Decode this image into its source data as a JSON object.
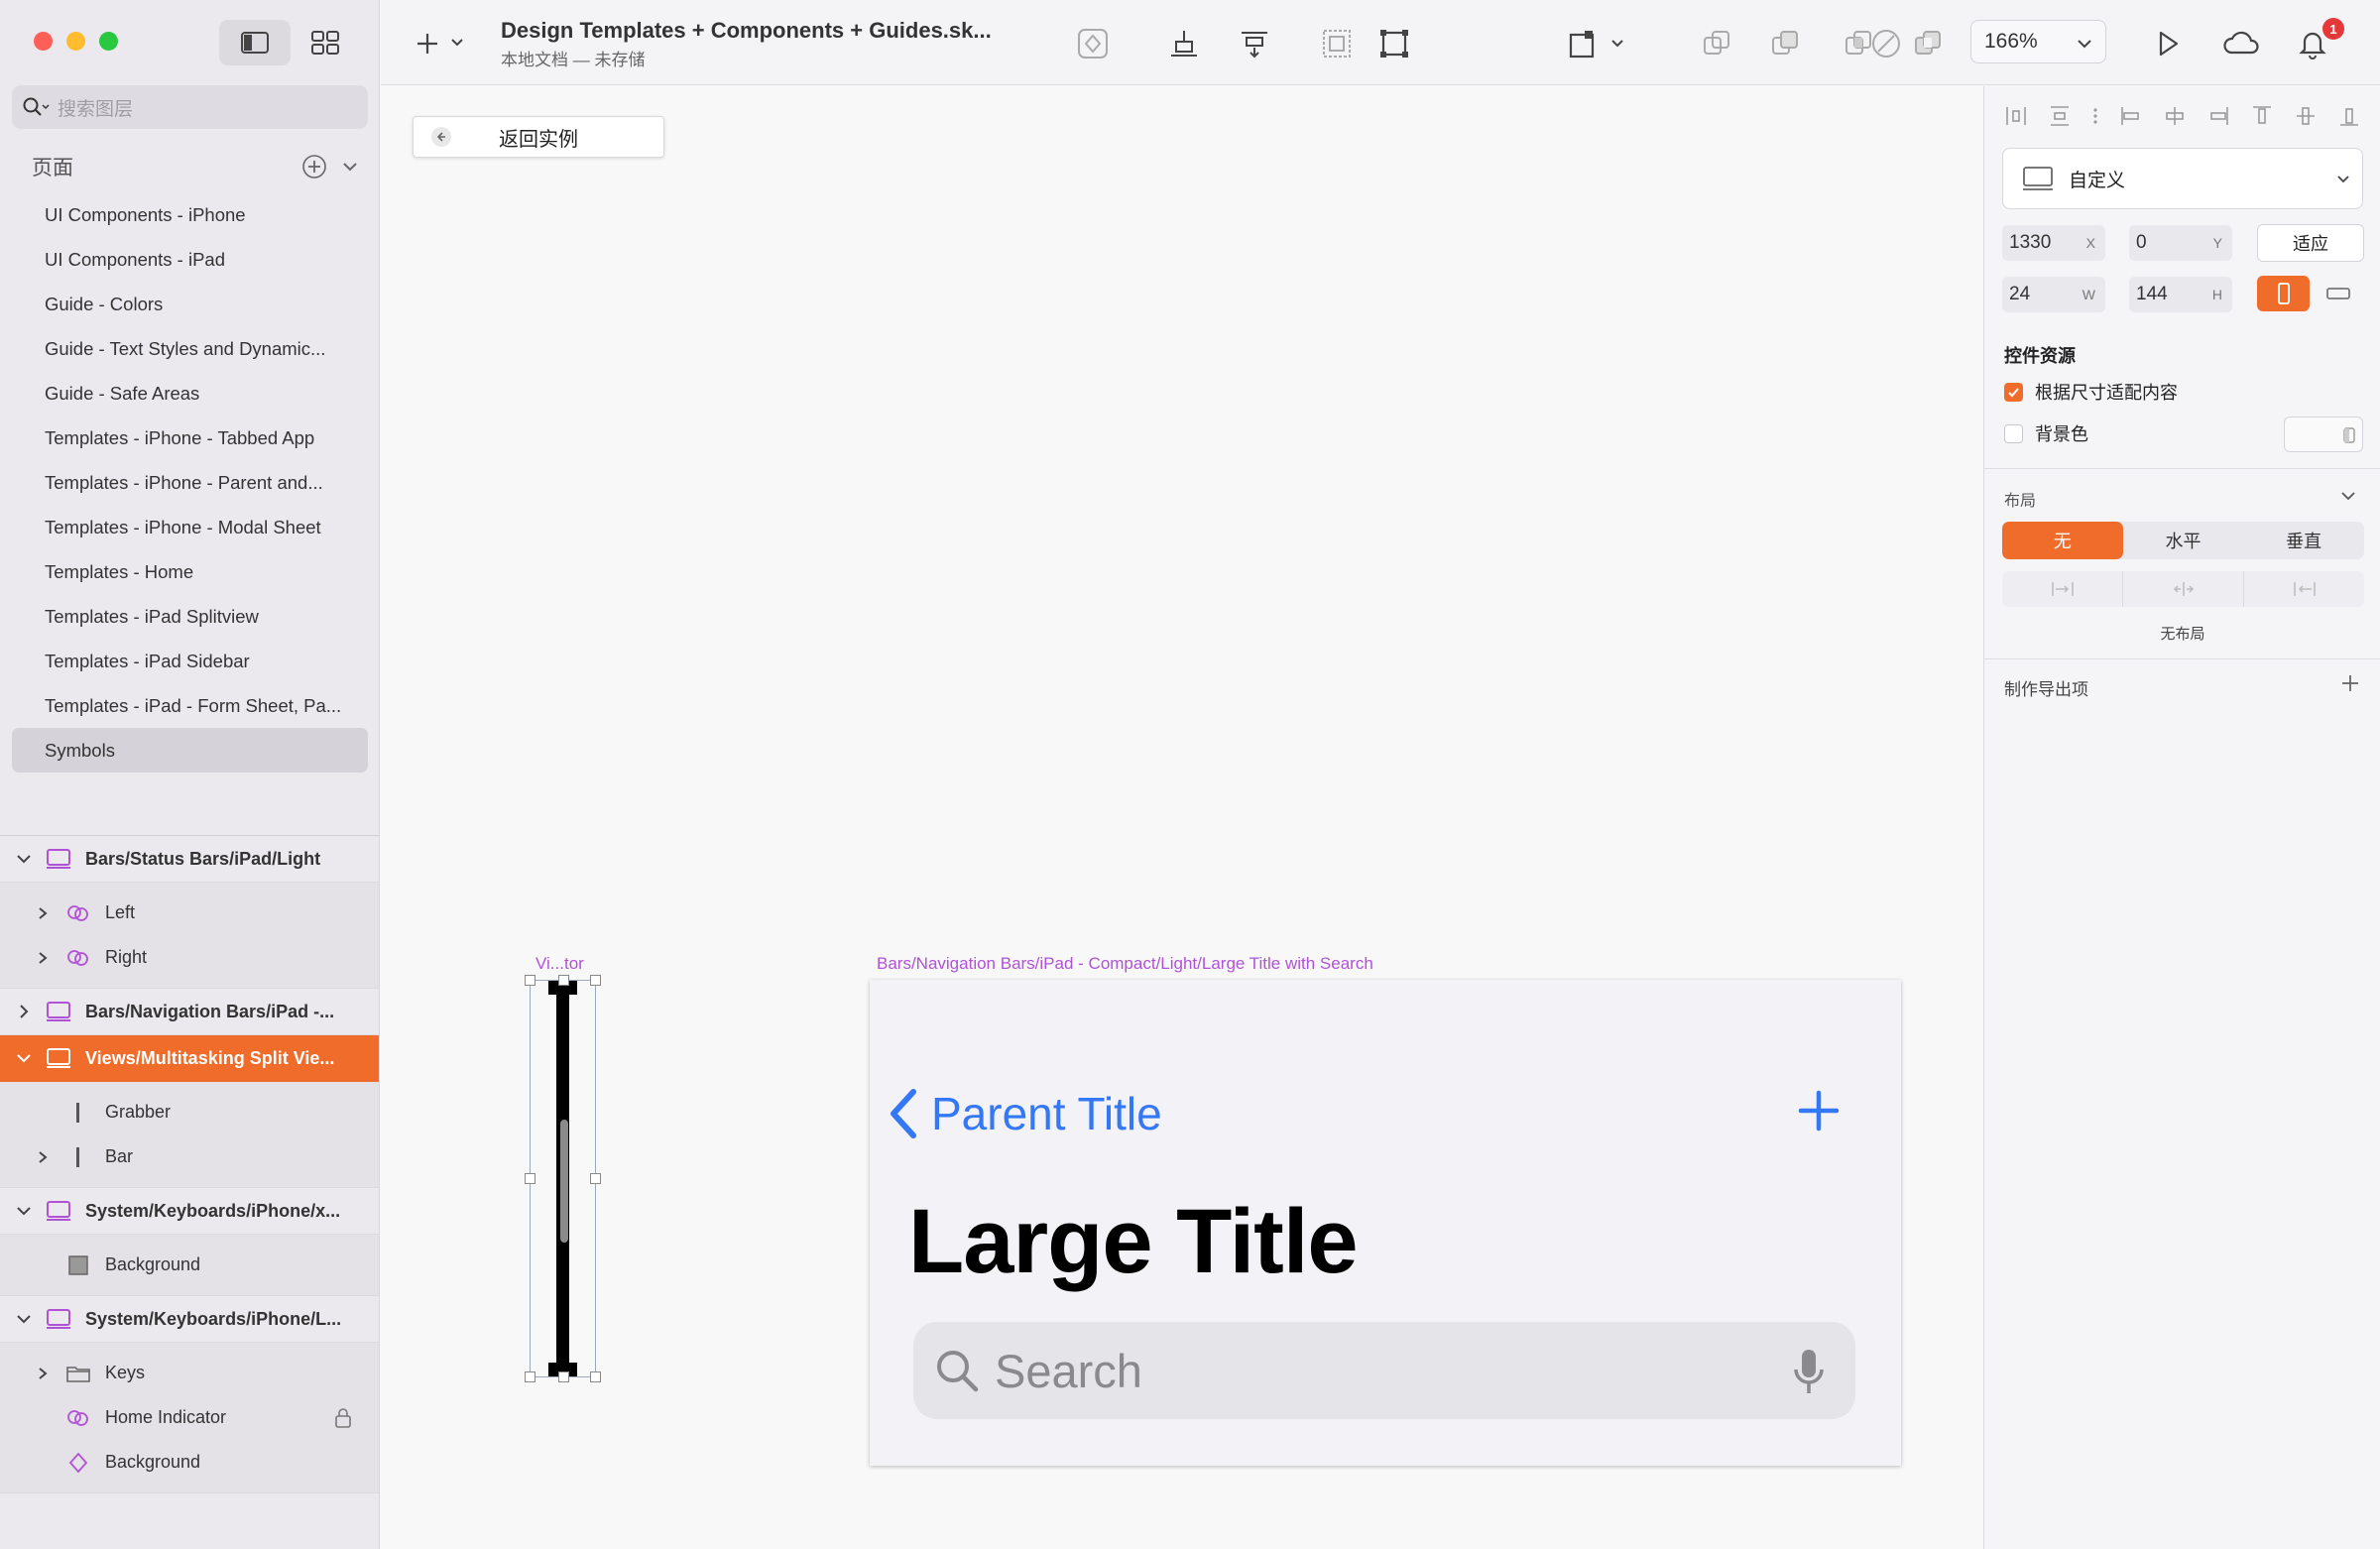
{
  "window": {
    "traffic_lights": [
      "close",
      "minimize",
      "zoom"
    ]
  },
  "sidebar": {
    "search_placeholder": "搜索图层",
    "pages_title": "页面",
    "pages": [
      "UI Components - iPhone",
      "UI Components - iPad",
      "Guide - Colors",
      "Guide - Text Styles and Dynamic...",
      "Guide - Safe Areas",
      "Templates - iPhone - Tabbed App",
      "Templates - iPhone - Parent and...",
      "Templates - iPhone - Modal Sheet",
      "Templates - Home",
      "Templates - iPad Splitview",
      "Templates - iPad Sidebar",
      "Templates - iPad - Form Sheet, Pa...",
      "Symbols"
    ],
    "selected_page": "Symbols",
    "layers": {
      "g1": {
        "name": "Bars/Status Bars/iPad/Light",
        "children": [
          "Left",
          "Right"
        ]
      },
      "g2": {
        "name": "Bars/Navigation Bars/iPad -..."
      },
      "g3": {
        "name": "Views/Multitasking Split Vie...",
        "children": [
          "Grabber",
          "Bar"
        ]
      },
      "g4": {
        "name": "System/Keyboards/iPhone/x...",
        "children": [
          "Background"
        ]
      },
      "g5": {
        "name": "System/Keyboards/iPhone/L...",
        "children": [
          "Keys",
          "Home Indicator",
          "Background"
        ]
      }
    },
    "selected_layer": "Views/Multitasking Split Vie..."
  },
  "toolbar": {
    "doc_title": "Design Templates + Components + Guides.sk...",
    "doc_subtitle": "本地文档 — 未存储",
    "zoom": "166%",
    "notification_count": "1",
    "icons": [
      "insert-icon",
      "create-symbol-icon",
      "align-bottom-icon",
      "distribute-icon",
      "mask-icon",
      "scale-icon",
      "edit-path-icon",
      "transform-icon",
      "union-icon",
      "subtract-icon",
      "intersect-icon",
      "difference-icon",
      "play-icon",
      "cloud-icon",
      "bell-icon"
    ]
  },
  "canvas": {
    "back_button": "返回实例",
    "artboard1_label": "Vi...tor",
    "artboard2_label": "Bars/Navigation Bars/iPad - Compact/Light/Large Title with Search",
    "nav": {
      "back_title": "Parent Title",
      "large_title": "Large Title",
      "search_placeholder": "Search"
    },
    "accent_color": "#3478f6"
  },
  "inspector": {
    "symbol_name": "自定义",
    "x": "1330",
    "x_unit": "X",
    "y": "0",
    "y_unit": "Y",
    "w": "24",
    "w_unit": "W",
    "h": "144",
    "h_unit": "H",
    "fit_button": "适应",
    "symbol_source_title": "控件资源",
    "resize_to_fit": "根据尺寸适配内容",
    "resize_to_fit_checked": true,
    "background_color": "背景色",
    "background_checked": false,
    "layout_title": "布局",
    "layout_options": [
      "无",
      "水平",
      "垂直"
    ],
    "layout_selected": "无",
    "no_layout": "无布局",
    "export_title": "制作导出项",
    "accent_color": "#f06c2b"
  }
}
